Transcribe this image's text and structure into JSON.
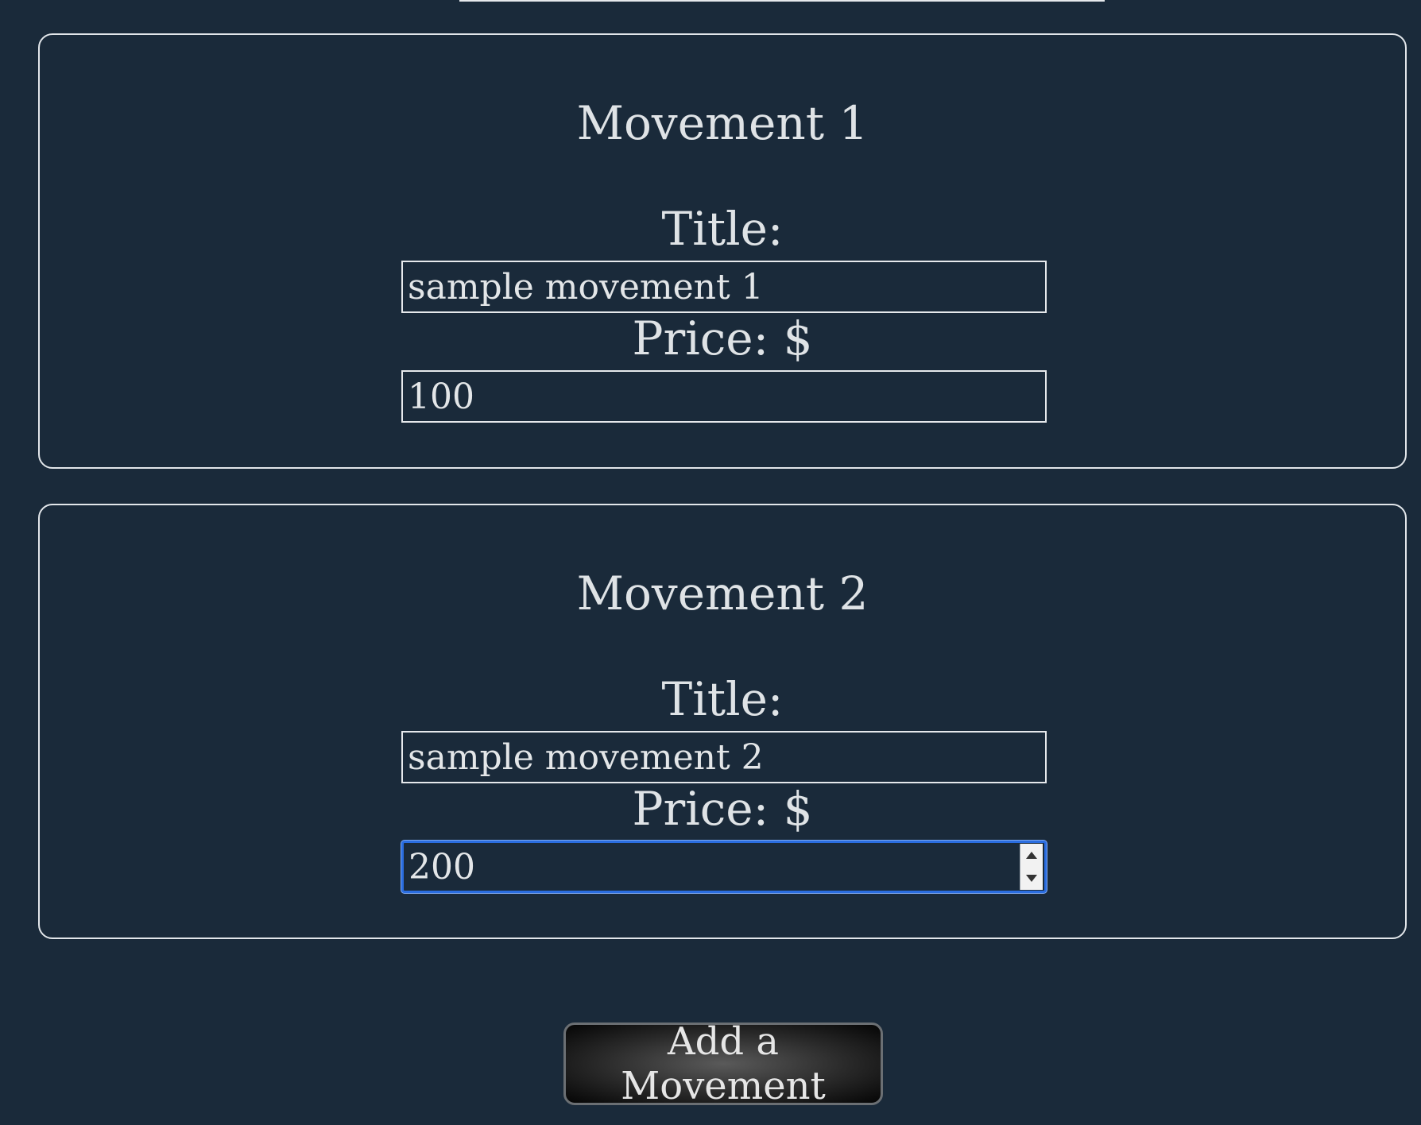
{
  "movements": [
    {
      "heading": "Movement 1",
      "title_label": "Title:",
      "title_value": "sample movement 1",
      "price_label": "Price: $",
      "price_value": "100"
    },
    {
      "heading": "Movement 2",
      "title_label": "Title:",
      "title_value": "sample movement 2",
      "price_label": "Price: $",
      "price_value": "200",
      "price_focused": true
    }
  ],
  "add_button_label": "Add a Movement",
  "colors": {
    "background": "#1a2a3a",
    "text": "#dfe3e6",
    "border": "#e2e6ea",
    "focus_ring": "#2a6de0"
  },
  "icons": {
    "spinner_up": "triangle-up",
    "spinner_down": "triangle-down"
  }
}
